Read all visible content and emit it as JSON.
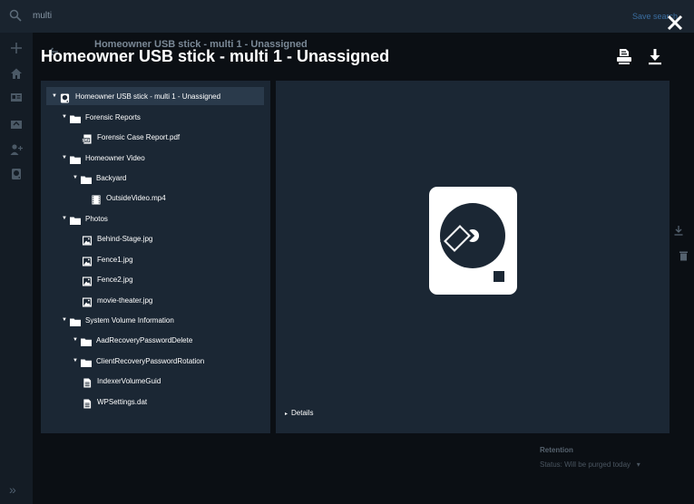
{
  "background": {
    "search_query": "multi",
    "save_search_label": "Save search",
    "title_behind": "Homeowner USB stick - multi 1 - Unassigned",
    "retention_label": "Retention",
    "status_text": "Status: Will be purged today",
    "status_chevron": "▾",
    "expand_glyph": "»"
  },
  "modal": {
    "title": "Homeowner USB stick - multi 1 - Unassigned",
    "details_caret": "▸",
    "details_label": "Details",
    "preview_icon": "usb-drive-icon"
  },
  "tree": {
    "caret_open": "▼",
    "items": [
      {
        "label": "Homeowner USB stick - multi 1 - Unassigned",
        "icon": "drive-icon",
        "expanded": true,
        "selected": true
      },
      {
        "label": "Forensic Reports",
        "icon": "folder-icon",
        "expanded": true
      },
      {
        "label": "Forensic Case Report.pdf",
        "icon": "pdf-icon"
      },
      {
        "label": "Homeowner Video",
        "icon": "folder-icon",
        "expanded": true
      },
      {
        "label": "Backyard",
        "icon": "folder-icon",
        "expanded": true
      },
      {
        "label": "OutsideVideo.mp4",
        "icon": "video-icon"
      },
      {
        "label": "Photos",
        "icon": "folder-icon",
        "expanded": true
      },
      {
        "label": "Behind-Stage.jpg",
        "icon": "image-icon"
      },
      {
        "label": "Fence1.jpg",
        "icon": "image-icon"
      },
      {
        "label": "Fence2.jpg",
        "icon": "image-icon"
      },
      {
        "label": "movie-theater.jpg",
        "icon": "image-icon"
      },
      {
        "label": "System Volume Information",
        "icon": "folder-icon",
        "expanded": true
      },
      {
        "label": "AadRecoveryPasswordDelete",
        "icon": "folder-icon",
        "expanded": true
      },
      {
        "label": "ClientRecoveryPasswordRotation",
        "icon": "folder-icon",
        "expanded": true
      },
      {
        "label": "IndexerVolumeGuid",
        "icon": "file-icon"
      },
      {
        "label": "WPSettings.dat",
        "icon": "file-icon"
      }
    ]
  }
}
